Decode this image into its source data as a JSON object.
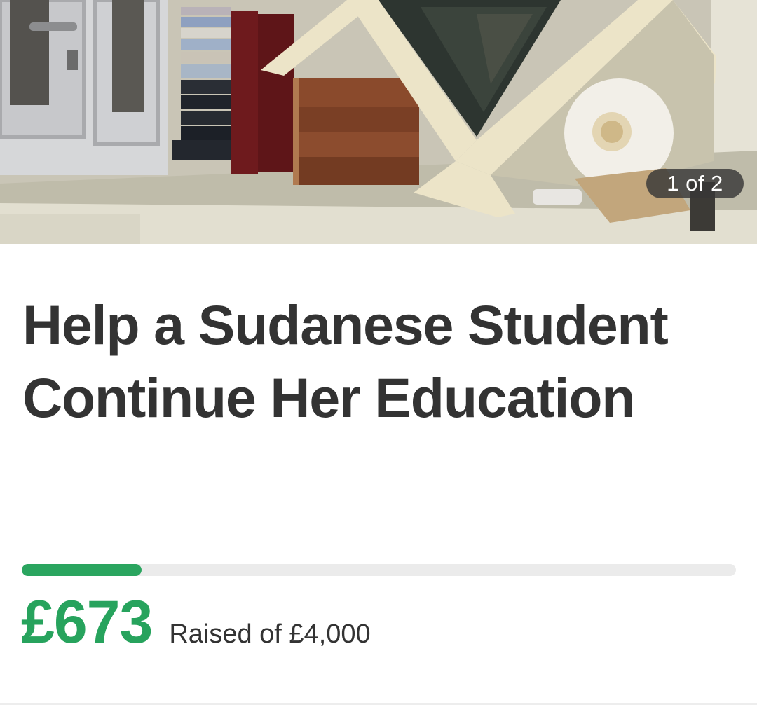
{
  "hero": {
    "image": "bookshelf-with-books-and-ornament-photo",
    "counter": "1 of 2"
  },
  "campaign": {
    "title": "Help a Sudanese Student Continue Her Education",
    "raised": "£673",
    "raised_label": "Raised of £4,000",
    "progress_fraction": 0.168
  },
  "colors": {
    "accent": "#27a35d",
    "progress_track": "#ebebeb",
    "text": "#333333"
  }
}
